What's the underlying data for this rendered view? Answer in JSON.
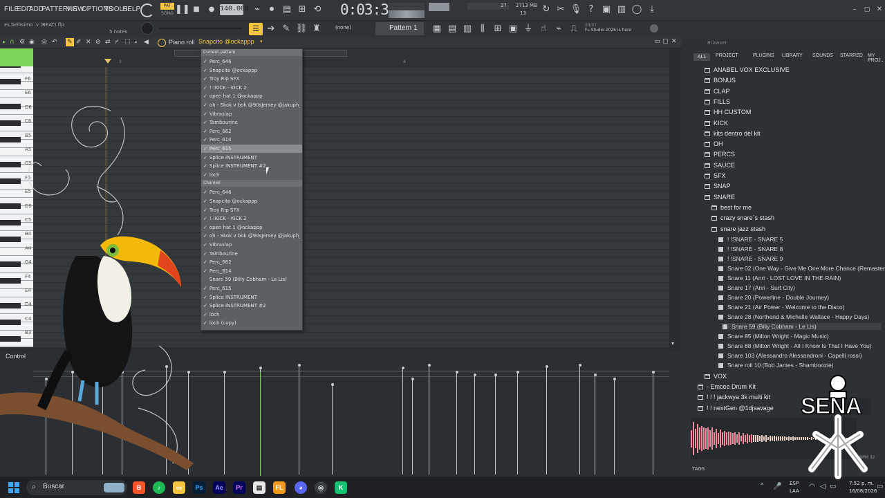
{
  "menu": [
    "FILE",
    "EDIT",
    "ADD",
    "PATTERNS",
    "VIEW",
    "OPTIONS",
    "TOOLS",
    "HELP"
  ],
  "transport": {
    "pat_label": "PAT",
    "song_label": "SONG",
    "tempo": "140.000",
    "time": "0:03:37",
    "cpu_mem": "2713 MB",
    "cpu_num": "13",
    "vol_num": "27"
  },
  "project": {
    "file": "es bellisimo .v (BEAT).flp",
    "notes": "5 notes"
  },
  "toolbar2": {
    "none_label": "(none)",
    "pattern_label": "Pattern 1",
    "news_date": "09/07",
    "news_text": "FL Studio 2026 is here"
  },
  "piano_roll": {
    "title": "Piano roll",
    "instrument": "Snapcito @ockappp",
    "ruler_marks": [
      "3",
      "4"
    ],
    "control_label": "Control"
  },
  "keys": [
    "F6",
    "E6",
    "D6",
    "C6",
    "B5",
    "A5",
    "G5",
    "F5",
    "E5",
    "D5",
    "C5",
    "B4",
    "A4",
    "G4",
    "F4",
    "E4",
    "D4",
    "C4",
    "B3"
  ],
  "dropdown": {
    "header1": "Current pattern",
    "current": [
      "Perc_646",
      "Snapcito @ockappp",
      "Troy Rip SFX",
      "! !KICK - KICK 2",
      "open hat 1 @ockappp",
      "oh - Skok v bok @90sJersey @jakuph_",
      "Vibraslap",
      "Tambourine",
      "Perc_662",
      "Perc_614",
      "Perc_615",
      "Splice INSTRUMENT",
      "Splice INSTRUMENT #2",
      "loch"
    ],
    "header2": "Channel",
    "channels": [
      "Perc_646",
      "Snapcito @ockappp",
      "Troy Rip SFX",
      "! !KICK - KICK 2",
      "open hat 1 @ockappp",
      "oh - Skok v bok @90sJersey @jakuph_",
      "Vibraslap",
      "Tambourine",
      "Perc_662",
      "Perc_614",
      "Snare 59 (Billy Cobham - Le Lis)",
      "Perc_615",
      "Splice INSTRUMENT",
      "Splice INSTRUMENT #2",
      "loch",
      "loch (copy)"
    ]
  },
  "browser": {
    "title": "Browser",
    "tabs": [
      "ALL",
      "PROJECT",
      "PLUGINS",
      "LIBRARY",
      "SOUNDS",
      "STARRED",
      "MY PROJ..."
    ],
    "folders": [
      "ANABEL VOX EXCLUSIVE",
      "BONUS",
      "CLAP",
      "FILLS",
      "HH CUSTOM",
      "KICK",
      "kits dentro del kit",
      "OH",
      "PERCS",
      "SAUCE",
      "SFX",
      "SNAP",
      "SNARE"
    ],
    "subfolders": [
      "best for me",
      "crazy snare´s stash",
      "snare jazz stash"
    ],
    "files": [
      "! !SNARE - SNARE 5",
      "! !SNARE - SNARE 8",
      "! !SNARE - SNARE 9",
      "Snare 02 (One Way - Give Me One More Chance (Remastered))",
      "Snare 11 (Anri - LOST LOVE IN THE RAIN)",
      "Snare 17 (Anri - Surf City)",
      "Snare 20 (Powerline - Double Journey)",
      "Snare 21 (Air Power - Welcome to the Disco)",
      "Snare 28 (Northend & Michelle Wallace - Happy Days)",
      "Snare 59 (Billy Cobham - Le Lis)",
      "Snare 85 (Milton Wright - Magic Music)",
      "Snare 88 (Milton Wright - All I Know Is That I Have You)",
      "Snare 103 (Alessandro Alessandroni - Capelli rossi)",
      "Snare roll 10 (Bob James - Shamboozie)"
    ],
    "bottom_folders": [
      "VOX",
      "- Emcee Drum Kit",
      "! ! ! jackwya 3k multi kit",
      "! ! nextGen @1djsavage"
    ],
    "tags_label": "TAGS",
    "bpm_label": "BPM 32"
  },
  "taskbar": {
    "search": "Buscar",
    "lang1": "ESP",
    "lang2": "LAA",
    "time": "7:52 p. m.",
    "date": "16/08/2026"
  },
  "logo_text": "SENA",
  "colors": {
    "accent": "#f5c542",
    "selection": "#8a8d90",
    "green": "#7fd45a"
  }
}
